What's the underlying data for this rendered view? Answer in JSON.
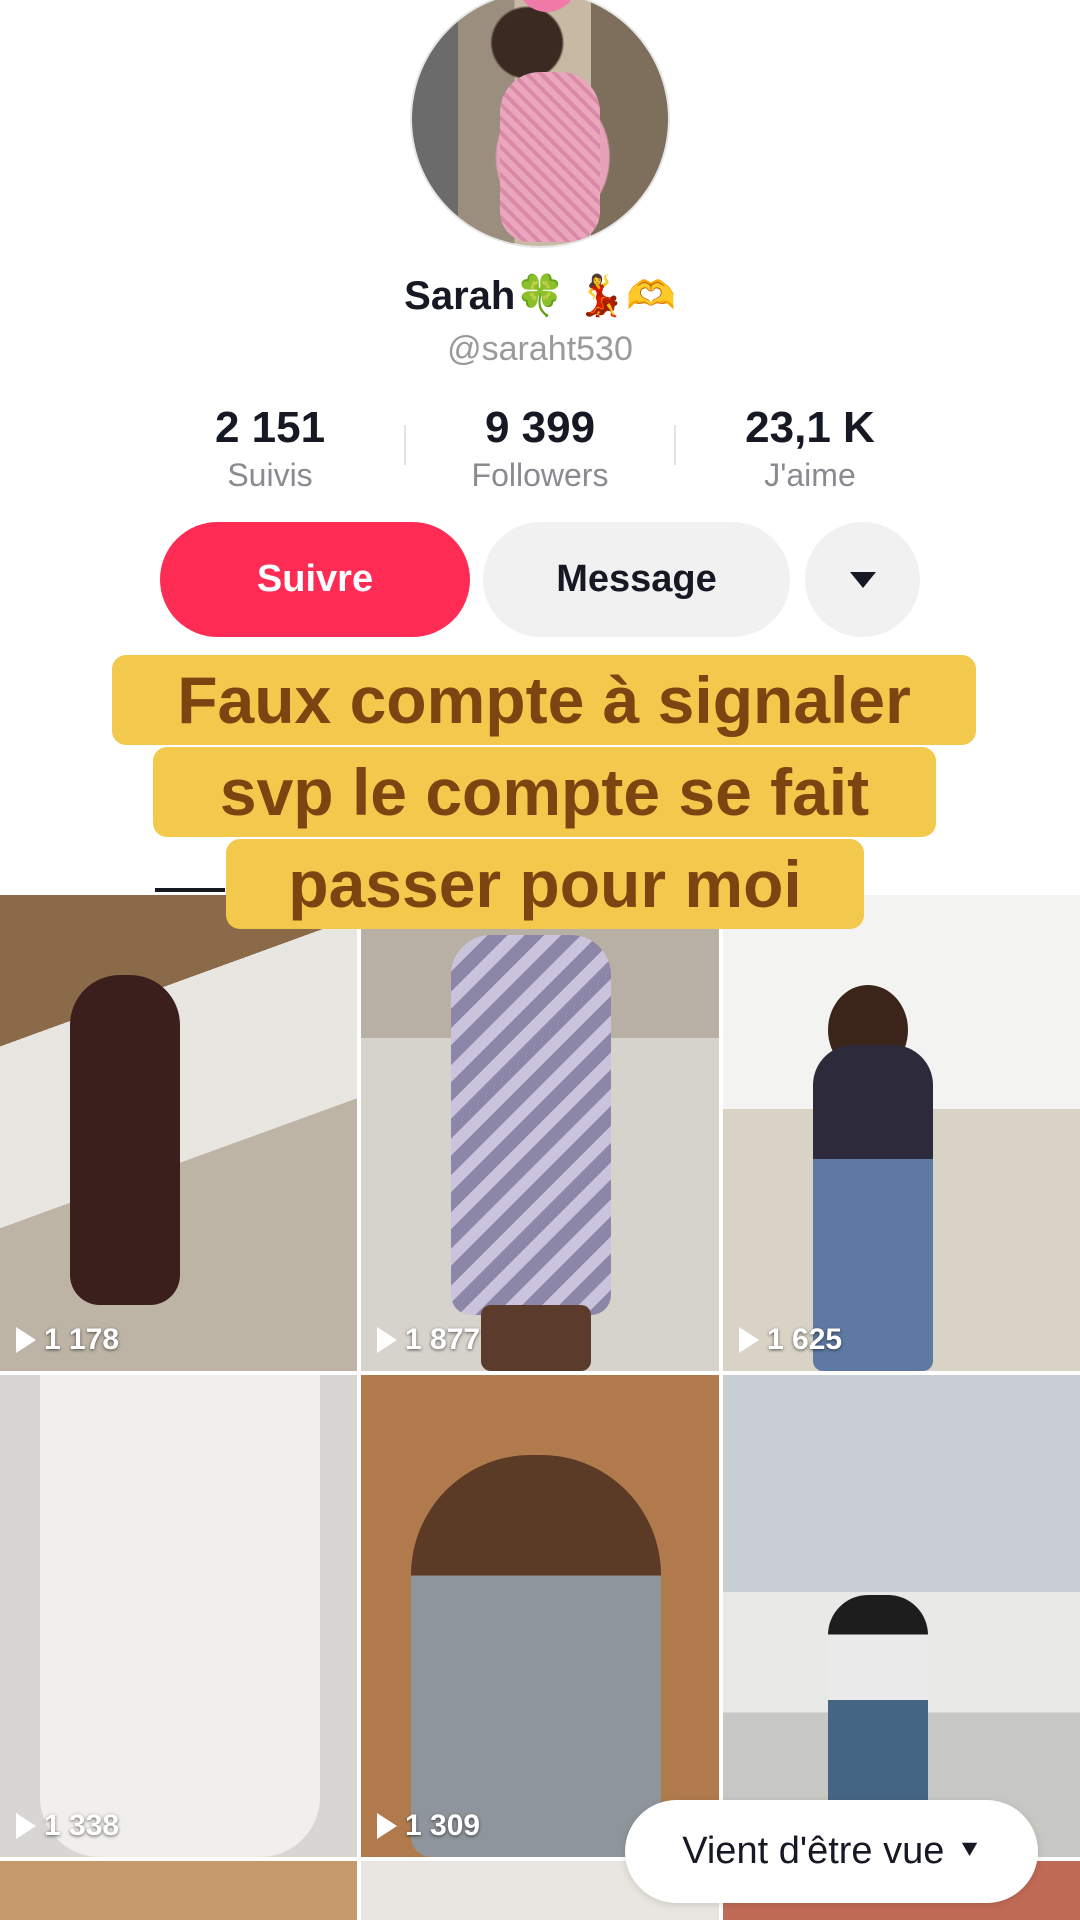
{
  "profile": {
    "display_name": "Sarah🍀 💃🫶",
    "handle": "@saraht530",
    "stats": [
      {
        "value": "2 151",
        "label": "Suivis"
      },
      {
        "value": "9 399",
        "label": "Followers"
      },
      {
        "value": "23,1 K",
        "label": "J'aime"
      }
    ]
  },
  "actions": {
    "follow_label": "Suivre",
    "message_label": "Message",
    "more_icon": "caret-down-icon"
  },
  "overlay": {
    "lines": [
      "Faux compte à signaler",
      "svp le compte se fait",
      "passer pour moi"
    ]
  },
  "videos": [
    {
      "views": "1 178"
    },
    {
      "views": "1 877"
    },
    {
      "views": "1 625"
    },
    {
      "views": "1 338"
    },
    {
      "views": "1 309"
    }
  ],
  "pill": {
    "label": "Vient d'être vue",
    "icon": "double-chevron-down-icon"
  },
  "colors": {
    "follow": "#fe2c55",
    "overlay_bg": "#f2c94c",
    "overlay_text": "#7a4510"
  }
}
